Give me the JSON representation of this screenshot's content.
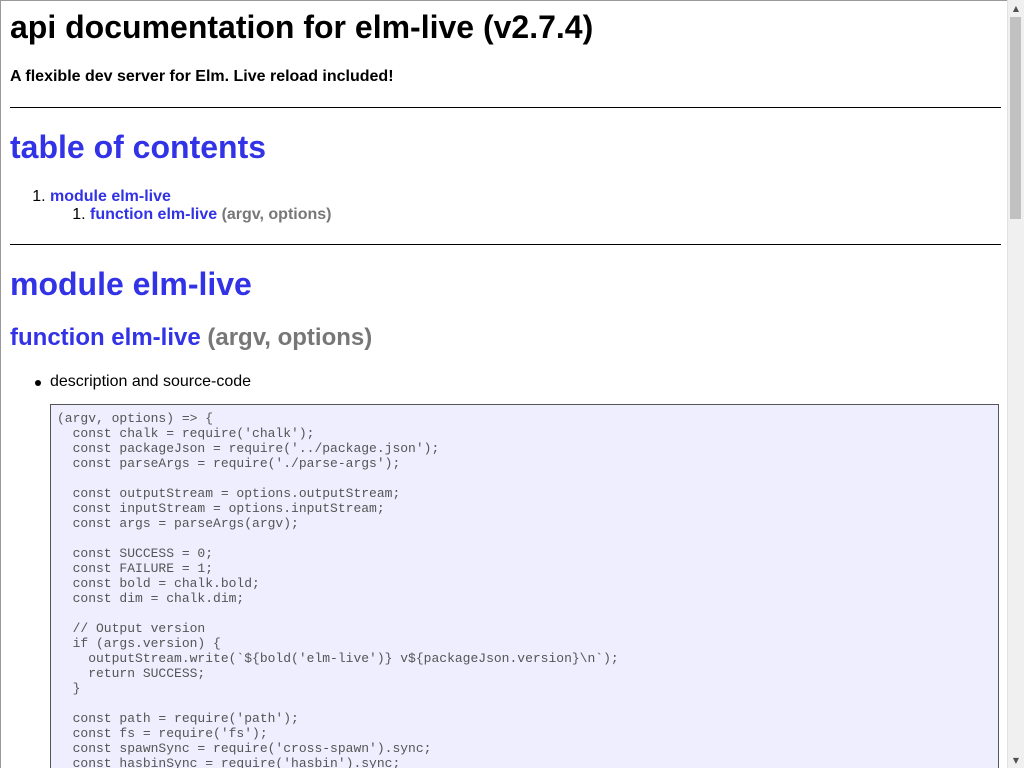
{
  "document": {
    "title": "api documentation for elm-live (v2.7.4)",
    "subtitle": "A flexible dev server for Elm. Live reload included!"
  },
  "toc": {
    "heading": "table of contents",
    "items": [
      {
        "number": "1.",
        "label": "module elm-live",
        "children": [
          {
            "number": "1.",
            "label": "function elm-live",
            "args": "(argv, options)"
          }
        ]
      }
    ]
  },
  "module": {
    "heading": "module elm-live",
    "function": {
      "name": "function elm-live",
      "args": "(argv, options)",
      "bullet_label": "description and source-code",
      "source_code": "(argv, options) => {\n  const chalk = require('chalk');\n  const packageJson = require('../package.json');\n  const parseArgs = require('./parse-args');\n\n  const outputStream = options.outputStream;\n  const inputStream = options.inputStream;\n  const args = parseArgs(argv);\n\n  const SUCCESS = 0;\n  const FAILURE = 1;\n  const bold = chalk.bold;\n  const dim = chalk.dim;\n\n  // Output version\n  if (args.version) {\n    outputStream.write(`${bold('elm-live')} v${packageJson.version}\\n`);\n    return SUCCESS;\n  }\n\n  const path = require('path');\n  const fs = require('fs');\n  const spawnSync = require('cross-spawn').sync;\n  const hasbinSync = require('hasbin').sync;"
    }
  },
  "scrollbar": {
    "up_icon": "triangle-up-icon",
    "down_icon": "triangle-down-icon"
  },
  "colors": {
    "link": "#3232e6",
    "muted": "#777777",
    "code_background": "#eeeeff"
  }
}
